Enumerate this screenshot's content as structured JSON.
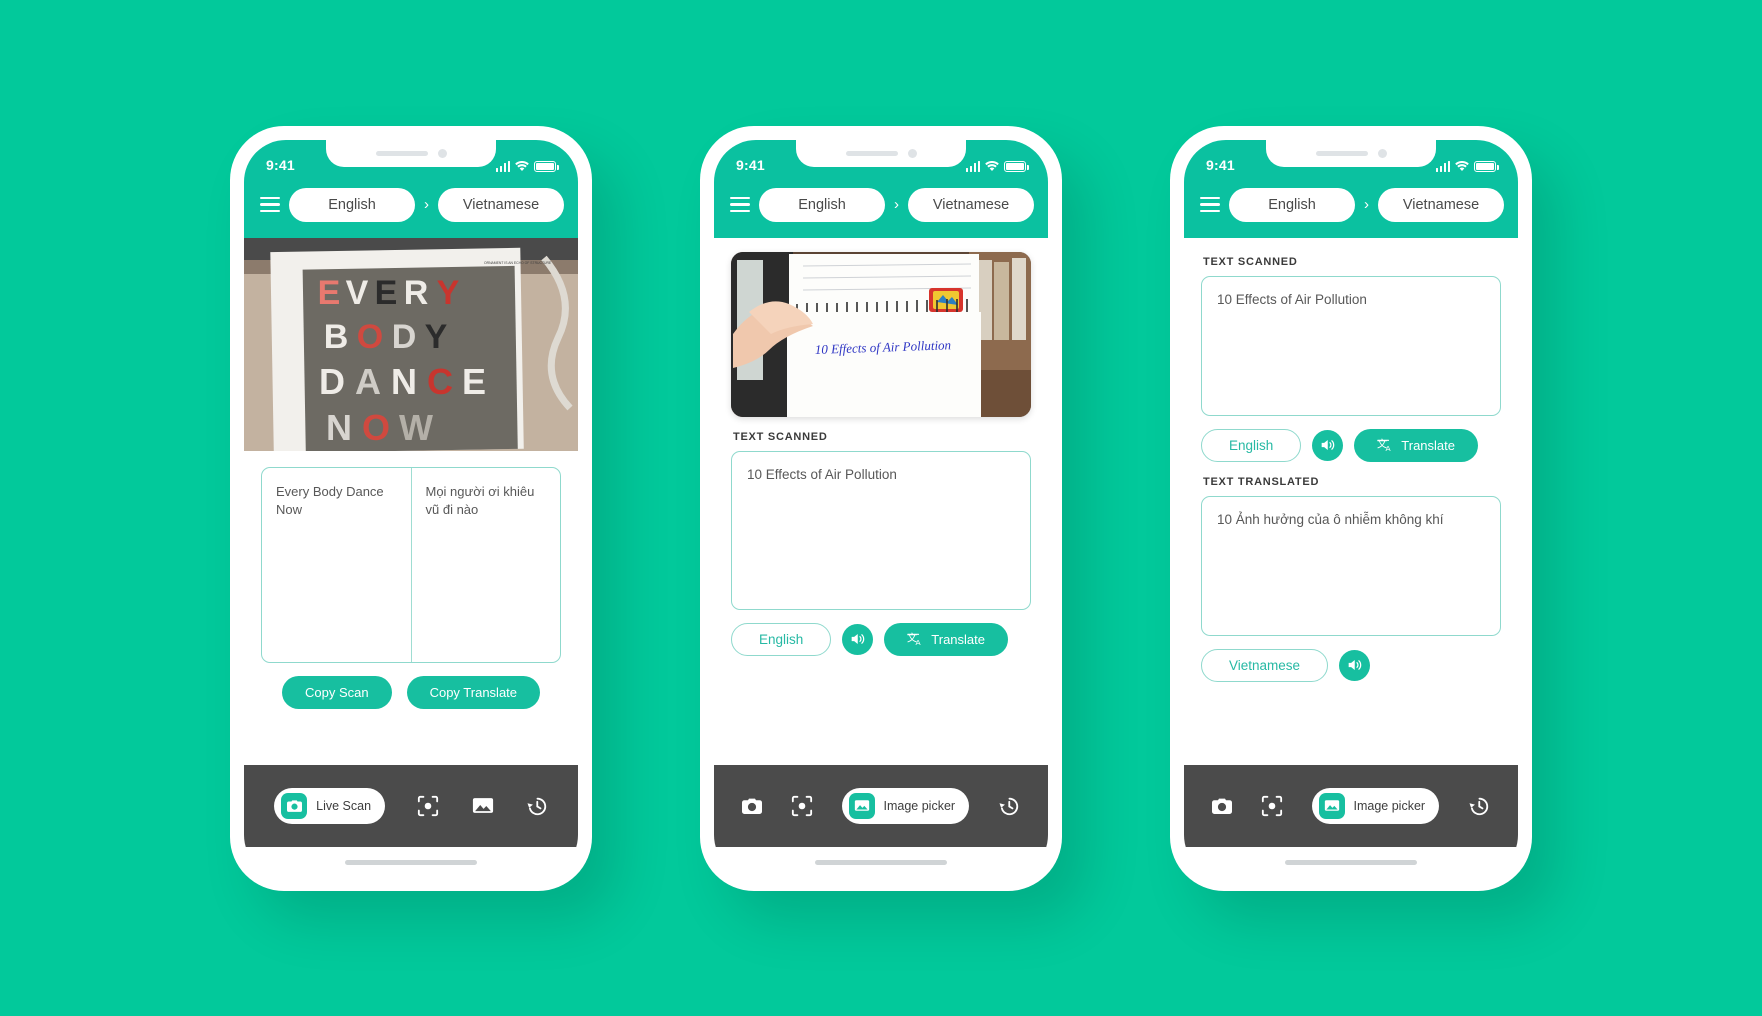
{
  "theme": {
    "background": "#02C99B",
    "header": "#0BC1A0",
    "accent": "#17BFA0",
    "border": "#8FD9CD",
    "nav_bar": "#4B4B4B"
  },
  "status_bar": {
    "time": "9:41",
    "icons": [
      "signal-icon",
      "wifi-icon",
      "battery-icon"
    ]
  },
  "header": {
    "menu_icon": "hamburger-menu-icon",
    "source_language": "English",
    "arrow": "›",
    "target_language": "Vietnamese"
  },
  "phones": [
    {
      "id": "live-scan-screen",
      "photo": {
        "name": "magazine-typography-photo",
        "alt_text": "EVERY BODY DANCE NOW"
      },
      "split_box": {
        "scanned_text": "Every Body Dance Now",
        "translated_text": "Mọi người ơi khiêu vũ đi nào"
      },
      "buttons": [
        {
          "label": "Copy Scan",
          "style": "solid"
        },
        {
          "label": "Copy Translate",
          "style": "solid"
        }
      ],
      "bottom_nav": {
        "active_index": 0,
        "items": [
          {
            "icon": "camera-icon",
            "label": "Live Scan",
            "active": true
          },
          {
            "icon": "scan-frame-icon",
            "label": "",
            "active": false
          },
          {
            "icon": "image-icon",
            "label": "",
            "active": false
          },
          {
            "icon": "history-icon",
            "label": "",
            "active": false
          }
        ]
      }
    },
    {
      "id": "image-picker-scan-screen",
      "photo": {
        "name": "notebook-handwriting-photo",
        "alt_text": "10 Effects of Air Pollution"
      },
      "scanned": {
        "label": "TEXT SCANNED",
        "value": "10 Effects of Air Pollution"
      },
      "action_row": {
        "language": "English",
        "speaker_icon": "speaker-icon",
        "translate_icon": "translate-icon",
        "translate_label": "Translate"
      },
      "bottom_nav": {
        "active_index": 2,
        "items": [
          {
            "icon": "camera-icon",
            "label": "",
            "active": false
          },
          {
            "icon": "scan-frame-icon",
            "label": "",
            "active": false
          },
          {
            "icon": "image-icon",
            "label": "Image picker",
            "active": true
          },
          {
            "icon": "history-icon",
            "label": "",
            "active": false
          }
        ]
      }
    },
    {
      "id": "translation-result-screen",
      "scanned": {
        "label": "TEXT SCANNED",
        "value": "10 Effects of Air Pollution"
      },
      "scanned_action_row": {
        "language": "English",
        "speaker_icon": "speaker-icon",
        "translate_icon": "translate-icon",
        "translate_label": "Translate"
      },
      "translated": {
        "label": "TEXT TRANSLATED",
        "value": "10 Ảnh hưởng của ô nhiễm không khí"
      },
      "translated_action_row": {
        "language": "Vietnamese",
        "speaker_icon": "speaker-icon"
      },
      "bottom_nav": {
        "active_index": 2,
        "items": [
          {
            "icon": "camera-icon",
            "label": "",
            "active": false
          },
          {
            "icon": "scan-frame-icon",
            "label": "",
            "active": false
          },
          {
            "icon": "image-icon",
            "label": "Image picker",
            "active": true
          },
          {
            "icon": "history-icon",
            "label": "",
            "active": false
          }
        ]
      }
    }
  ]
}
